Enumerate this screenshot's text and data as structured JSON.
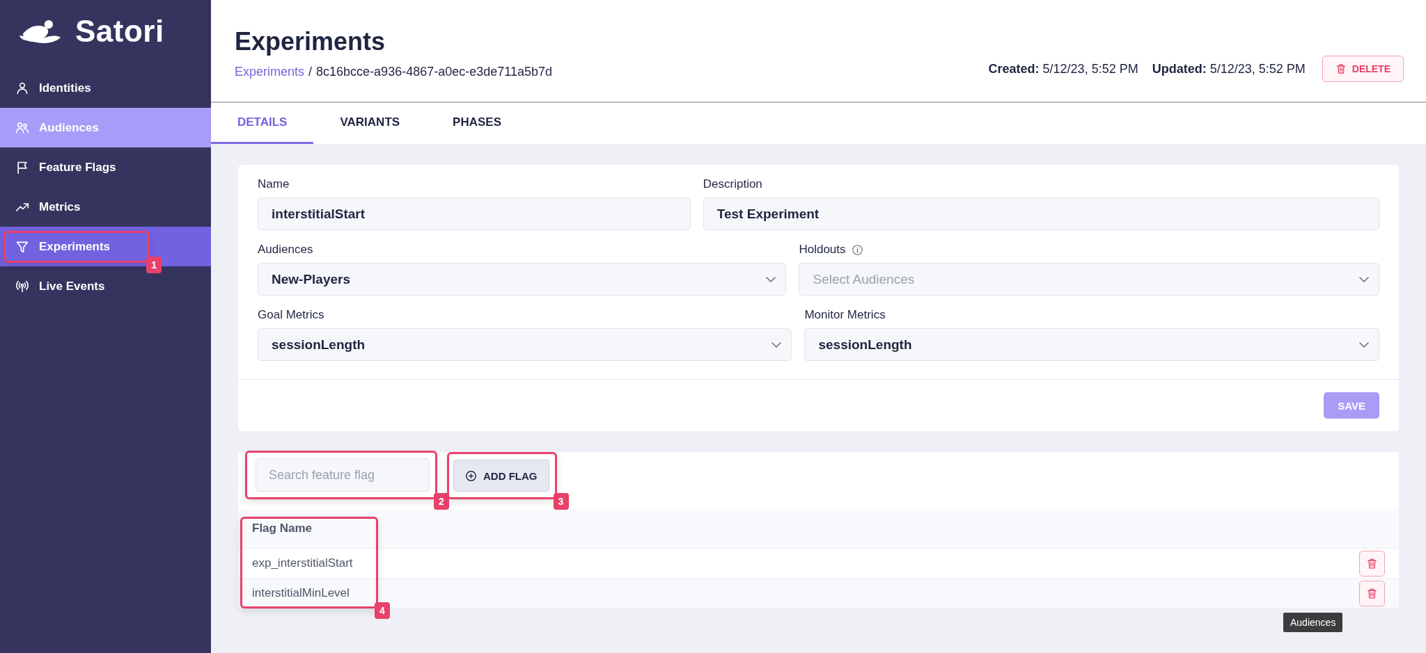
{
  "brand": {
    "name": "Satori"
  },
  "sidebar": {
    "items": [
      {
        "label": "Identities",
        "selected": false,
        "hovered": false
      },
      {
        "label": "Audiences",
        "selected": false,
        "hovered": true
      },
      {
        "label": "Feature Flags",
        "selected": false,
        "hovered": false
      },
      {
        "label": "Metrics",
        "selected": false,
        "hovered": false
      },
      {
        "label": "Experiments",
        "selected": true,
        "hovered": false,
        "callout": "1"
      },
      {
        "label": "Live Events",
        "selected": false,
        "hovered": false
      }
    ]
  },
  "header": {
    "title": "Experiments",
    "breadcrumb": {
      "link": "Experiments",
      "separator": "/",
      "current": "8c16bcce-a936-4867-a0ec-e3de711a5b7d"
    },
    "created_label": "Created:",
    "created": "5/12/23, 5:52 PM",
    "updated_label": "Updated:",
    "updated": "5/12/23, 5:52 PM",
    "delete_button": "DELETE"
  },
  "tabs": [
    {
      "label": "DETAILS",
      "selected": true
    },
    {
      "label": "VARIANTS",
      "selected": false
    },
    {
      "label": "PHASES",
      "selected": false
    }
  ],
  "form": {
    "rows": [
      [
        {
          "label": "Name",
          "kind": "text",
          "value": "interstitialStart"
        },
        {
          "label": "Description",
          "kind": "text",
          "value": "Test Experiment"
        }
      ],
      [
        {
          "label": "Audiences",
          "kind": "select",
          "value": "New-Players"
        },
        {
          "label": "Holdouts",
          "kind": "select",
          "info": true,
          "placeholder": "Select Audiences"
        }
      ],
      [
        {
          "label": "Goal Metrics",
          "kind": "select",
          "value": "sessionLength"
        },
        {
          "label": "Monitor Metrics",
          "kind": "select",
          "value": "sessionLength"
        }
      ]
    ],
    "save_button": "SAVE",
    "save_disabled": true
  },
  "flags": {
    "search": {
      "placeholder": "Search feature flag",
      "callout": "2"
    },
    "add_button": {
      "label": "ADD FLAG",
      "callout": "3"
    },
    "table": {
      "columns": [
        "Flag Name"
      ],
      "callout": "4",
      "rows": [
        {
          "name": "exp_interstitialStart"
        },
        {
          "name": "interstitialMinLevel"
        }
      ]
    }
  },
  "tooltip": {
    "text": "Audiences"
  }
}
